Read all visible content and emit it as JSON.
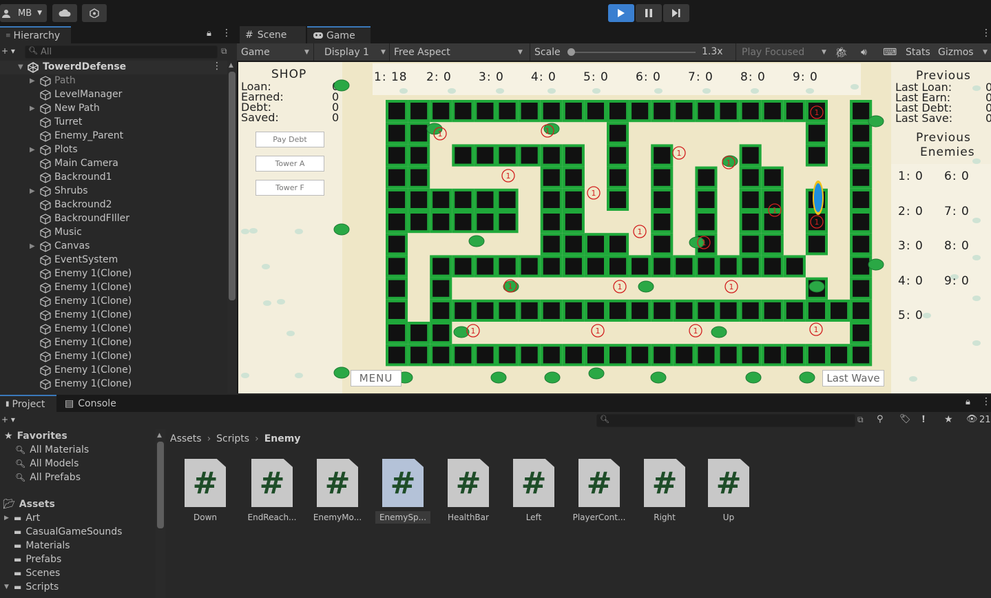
{
  "toolbar": {
    "account": "MB"
  },
  "hierarchy": {
    "tab": "Hierarchy",
    "search_placeholder": "All",
    "root": "TowerdDefense",
    "items": [
      "Path",
      "LevelManager",
      "New Path",
      "Turret",
      "Enemy_Parent",
      "Plots",
      "Main Camera",
      "Backround1",
      "Shrubs",
      "Backround2",
      "BackroundFIller",
      "Music",
      "Canvas",
      "EventSystem",
      "Enemy 1(Clone)",
      "Enemy 1(Clone)",
      "Enemy 1(Clone)",
      "Enemy 1(Clone)",
      "Enemy 1(Clone)",
      "Enemy 1(Clone)",
      "Enemy 1(Clone)",
      "Enemy 1(Clone)",
      "Enemy 1(Clone)"
    ]
  },
  "tabs": {
    "scene": "Scene",
    "game": "Game"
  },
  "game_toolbar": {
    "mode": "Game",
    "display": "Display 1",
    "aspect": "Free Aspect",
    "scale_label": "Scale",
    "scale_value": "1.3x",
    "play_focused": "Play Focused",
    "stats": "Stats",
    "gizmos": "Gizmos"
  },
  "game": {
    "shop": {
      "title": "SHOP",
      "loan_label": "Loan:",
      "earned_label": "Earned:",
      "debt_label": "Debt:",
      "saved_label": "Saved:",
      "loan": "0",
      "earned": "0",
      "debt": "0",
      "saved": "0",
      "pay_debt": "Pay Debt",
      "tower_a": "Tower A",
      "tower_f": "Tower F"
    },
    "waves": [
      "1: 18",
      "2: 0",
      "3: 0",
      "4: 0",
      "5: 0",
      "6: 0",
      "7: 0",
      "8: 0",
      "9: 0"
    ],
    "previous": {
      "title": "Previous",
      "last_loan": "Last Loan:",
      "last_earn": "Last Earn:",
      "last_debt": "Last Debt:",
      "last_save": "Last Save:",
      "loan_val": "0",
      "earn_val": "0",
      "debt_val": "0",
      "save_val": "0"
    },
    "prev_enemies": {
      "title_1": "Previous",
      "title_2": "Enemies",
      "left": [
        "1: 0",
        "2: 0",
        "3: 0",
        "4: 0",
        "5: 0"
      ],
      "right": [
        "6: 0",
        "7: 0",
        "8: 0",
        "9: 0"
      ]
    },
    "menu": "MENU",
    "last_wave": "Last Wave",
    "enemy_label": "1"
  },
  "project": {
    "tab_project": "Project",
    "tab_console": "Console",
    "hidden_count": "21",
    "favorites": {
      "title": "Favorites",
      "items": [
        "All Materials",
        "All Models",
        "All Prefabs"
      ]
    },
    "assets": {
      "title": "Assets",
      "folders": [
        "Art",
        "CasualGameSounds",
        "Materials",
        "Prefabs",
        "Scenes",
        "Scripts"
      ]
    },
    "breadcrumb": [
      "Assets",
      "Scripts",
      "Enemy"
    ],
    "files": [
      "Down",
      "EndReach...",
      "EnemyMo...",
      "EnemySp...",
      "HealthBar",
      "Left",
      "PlayerCont...",
      "Right",
      "Up"
    ],
    "file_glyph": "#"
  },
  "colors": {
    "accent": "#3a7fd0",
    "wall_green": "#1fa83a",
    "wall_dark": "#111111",
    "sand": "#efe7c7",
    "enemy_red": "#d22020"
  }
}
